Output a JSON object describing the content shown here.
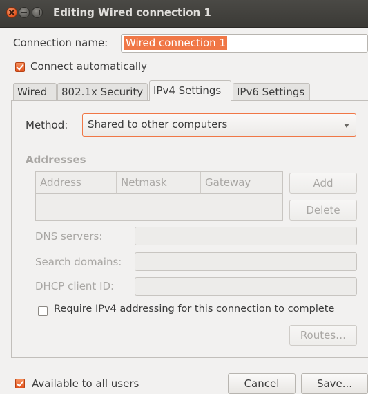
{
  "window": {
    "title": "Editing Wired connection 1"
  },
  "connection_name": {
    "label": "Connection name:",
    "value": "Wired connection 1"
  },
  "connect_auto": {
    "label": "Connect automatically",
    "checked": true
  },
  "tabs": [
    {
      "label": "Wired",
      "active": false
    },
    {
      "label": "802.1x Security",
      "active": false
    },
    {
      "label": "IPv4 Settings",
      "active": true
    },
    {
      "label": "IPv6 Settings",
      "active": false
    }
  ],
  "ipv4": {
    "method_label": "Method:",
    "method_value": "Shared to other computers",
    "addresses_heading": "Addresses",
    "columns": [
      "Address",
      "Netmask",
      "Gateway"
    ],
    "add_label": "Add",
    "delete_label": "Delete",
    "dns_label": "DNS servers:",
    "search_label": "Search domains:",
    "dhcp_label": "DHCP client ID:",
    "require_label": "Require IPv4 addressing for this connection to complete",
    "require_checked": false,
    "routes_label": "Routes…"
  },
  "footer": {
    "available_label": "Available to all users",
    "available_checked": true,
    "cancel_label": "Cancel",
    "save_label": "Save..."
  }
}
